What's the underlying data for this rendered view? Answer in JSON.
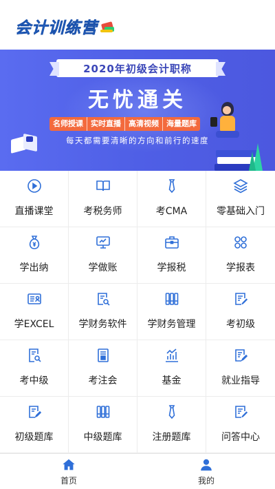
{
  "header": {
    "logo_text": "会计训练营",
    "logo_icon": "books-stack-icon"
  },
  "banner": {
    "ribbon_title": "2020年初级会计职称",
    "headline": "无忧通关",
    "tags": [
      "名师授课",
      "实时直播",
      "高清视频",
      "海量题库"
    ],
    "slogan": "每天都需要清晰的方向和前行的速度"
  },
  "menu": {
    "accent_color": "#2f6fd8",
    "items": [
      {
        "label": "直播课堂",
        "icon": "play-circle-icon"
      },
      {
        "label": "考税务师",
        "icon": "open-book-icon"
      },
      {
        "label": "考CMA",
        "icon": "tie-icon"
      },
      {
        "label": "零基础入门",
        "icon": "layers-icon"
      },
      {
        "label": "学出纳",
        "icon": "money-bag-icon"
      },
      {
        "label": "学做账",
        "icon": "monitor-icon"
      },
      {
        "label": "学报税",
        "icon": "briefcase-icon"
      },
      {
        "label": "学报表",
        "icon": "grid-clover-icon"
      },
      {
        "label": "学EXCEL",
        "icon": "id-card-icon"
      },
      {
        "label": "学财务软件",
        "icon": "document-search-icon"
      },
      {
        "label": "学财务管理",
        "icon": "binders-icon"
      },
      {
        "label": "考初级",
        "icon": "document-edit-icon"
      },
      {
        "label": "考中级",
        "icon": "document-search-icon"
      },
      {
        "label": "考注会",
        "icon": "document-file-icon"
      },
      {
        "label": "基金",
        "icon": "growth-chart-icon"
      },
      {
        "label": "就业指导",
        "icon": "document-pen-icon"
      },
      {
        "label": "初级题库",
        "icon": "document-pen-icon"
      },
      {
        "label": "中级题库",
        "icon": "binders-icon"
      },
      {
        "label": "注册题库",
        "icon": "tie-icon"
      },
      {
        "label": "问答中心",
        "icon": "document-edit-icon"
      }
    ]
  },
  "tabbar": {
    "home_label": "首页",
    "me_label": "我的",
    "active_color": "#2f6fd8"
  }
}
